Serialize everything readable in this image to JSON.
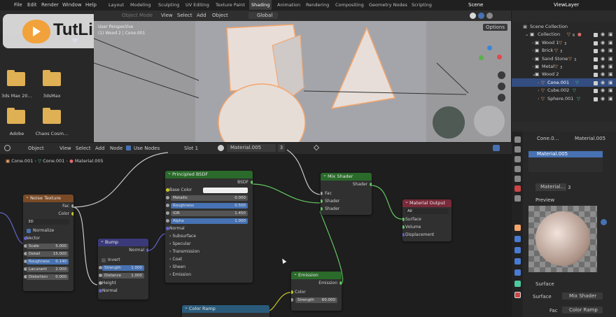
{
  "top_menu": {
    "file": "File",
    "edit": "Edit",
    "render": "Render",
    "window": "Window",
    "help": "Help"
  },
  "workspace_tabs": [
    "Layout",
    "Modeling",
    "Sculpting",
    "UV Editing",
    "Texture Paint",
    "Shading",
    "Animation",
    "Rendering",
    "Compositing",
    "Geometry Nodes",
    "Scripting"
  ],
  "scene": {
    "label": "Scene",
    "view_layer": "ViewLayer"
  },
  "watermark": "TutLibrary",
  "viewport": {
    "mode": "Object Mode",
    "view": "View",
    "select": "Select",
    "add": "Add",
    "object": "Object",
    "transform": "Global",
    "options": "Options",
    "info1": "User Perspective",
    "info2": "(1) Wood 2 | Cone.001"
  },
  "file_browser": {
    "folders": [
      "3ds Max 20…",
      "3dsMax",
      "Adobe",
      "Chaos Cosm…"
    ]
  },
  "outliner": {
    "rows": [
      {
        "label": "Scene Collection"
      },
      {
        "label": "Collection"
      },
      {
        "label": "Wood 1"
      },
      {
        "label": "Brick"
      },
      {
        "label": "Sand Stone"
      },
      {
        "label": "Metal"
      },
      {
        "label": "Wood 2"
      },
      {
        "label": "Cone.001"
      },
      {
        "label": "Cube.002"
      },
      {
        "label": "Sphere.001"
      }
    ],
    "subscripts": [
      "6",
      "3",
      "3",
      "3",
      "3"
    ]
  },
  "node_header": {
    "object": "Object",
    "view": "View",
    "select": "Select",
    "add": "Add",
    "node": "Node",
    "use_nodes": "Use Nodes",
    "slot": "Slot 1",
    "material": "Material.005",
    "users": "3"
  },
  "breadcrumb": {
    "a": "Cone.001",
    "b": "Cone.001",
    "c": "Material.005"
  },
  "nodes": {
    "noise": {
      "title": "Noise Texture",
      "out_fac": "Fac",
      "out_color": "Color",
      "dim": "3D",
      "normalize": "Normalize",
      "vector": "Vector",
      "fields": [
        {
          "k": "Scale",
          "v": "5.000"
        },
        {
          "k": "Detail",
          "v": "15.000"
        },
        {
          "k": "Roughness",
          "v": "0.140"
        },
        {
          "k": "Lacunarit",
          "v": "2.000"
        },
        {
          "k": "Distortion",
          "v": "0.000"
        }
      ]
    },
    "bump": {
      "title": "Bump",
      "out_normal": "Normal",
      "invert": "Invert",
      "strength_k": "Strength",
      "strength_v": "1.000",
      "distance_k": "Distance",
      "distance_v": "1.000",
      "height": "Height",
      "normal": "Normal"
    },
    "bsdf": {
      "title": "Principled BSDF",
      "out": "BSDF",
      "base_color": "Base Color",
      "fields": [
        {
          "k": "Metallic",
          "v": "0.000"
        },
        {
          "k": "Roughness",
          "v": "0.500"
        },
        {
          "k": "IOR",
          "v": "1.450"
        },
        {
          "k": "Alpha",
          "v": "1.000"
        }
      ],
      "normal": "Normal",
      "panels": [
        "Subsurface",
        "Specular",
        "Transmission",
        "Coat",
        "Sheen",
        "Emission"
      ]
    },
    "mix": {
      "title": "Mix Shader",
      "out": "Shader",
      "fac": "Fac",
      "sh1": "Shader",
      "sh2": "Shader"
    },
    "output": {
      "title": "Material Output",
      "target": "All",
      "surface": "Surface",
      "volume": "Volume",
      "displacement": "Displacement"
    },
    "emission": {
      "title": "Emission",
      "out": "Emission",
      "color": "Color",
      "strength_k": "Strength",
      "strength_v": "60.000"
    },
    "ramp": {
      "title": "Color Ramp"
    }
  },
  "props": {
    "obj": "Cone.0…",
    "mat_head": "Material.005",
    "slot_name": "Material.005",
    "mat2": "Material…",
    "users": "3",
    "preview": "Preview",
    "surface": "Surface",
    "surface_k": "Surface",
    "surface_v": "Mix Shader",
    "fac_k": "Fac",
    "fac_v": "Color Ramp"
  },
  "colors": {
    "accent": "#4772b3",
    "header_bg": "#2b2b2b",
    "node_bg": "#303030"
  }
}
